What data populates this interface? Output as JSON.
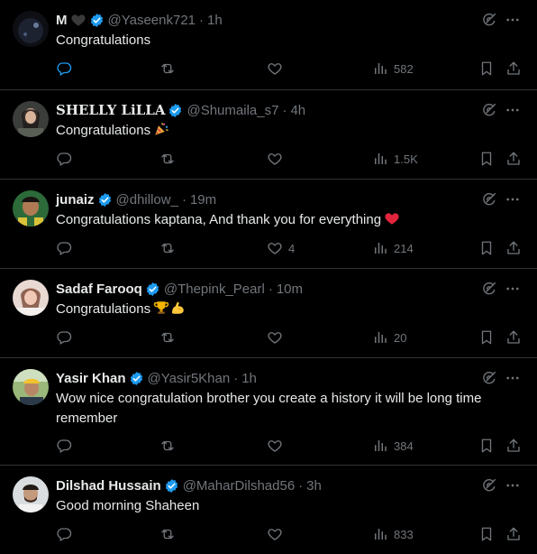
{
  "tweets": [
    {
      "name": "M",
      "handle": "@Yaseenk721",
      "time": "1h",
      "text": "Congratulations",
      "likes": "",
      "views": "582"
    },
    {
      "name": "SHELLY LiLLA",
      "handle": "@Shumaila_s7",
      "time": "4h",
      "text": "Congratulations",
      "likes": "",
      "views": "1.5K"
    },
    {
      "name": "junaiz",
      "handle": "@dhillow_",
      "time": "19m",
      "text": "Congratulations kaptana, And thank you for everything",
      "likes": "4",
      "views": "214"
    },
    {
      "name": "Sadaf Farooq",
      "handle": "@Thepink_Pearl",
      "time": "10m",
      "text": "Congratulations",
      "likes": "",
      "views": "20"
    },
    {
      "name": "Yasir Khan",
      "handle": "@Yasir5Khan",
      "time": "1h",
      "text": "Wow nice congratulation brother you create a history it will be long time remember",
      "likes": "",
      "views": "384"
    },
    {
      "name": "Dilshad Hussain",
      "handle": "@MaharDilshad56",
      "time": "3h",
      "text": "Good morning Shaheen",
      "likes": "",
      "views": "833"
    }
  ],
  "separator": "·",
  "icons": {
    "verified": "verified-badge-icon",
    "grok": "grok-icon",
    "more": "more-icon",
    "reply": "reply-icon",
    "retweet": "retweet-icon",
    "like": "heart-icon",
    "views": "views-icon",
    "bookmark": "bookmark-icon",
    "share": "share-icon"
  },
  "colors": {
    "background": "#000000",
    "text": "#e7e9ea",
    "muted": "#71767b",
    "verified": "#1d9bf0",
    "border": "#2f3336"
  }
}
